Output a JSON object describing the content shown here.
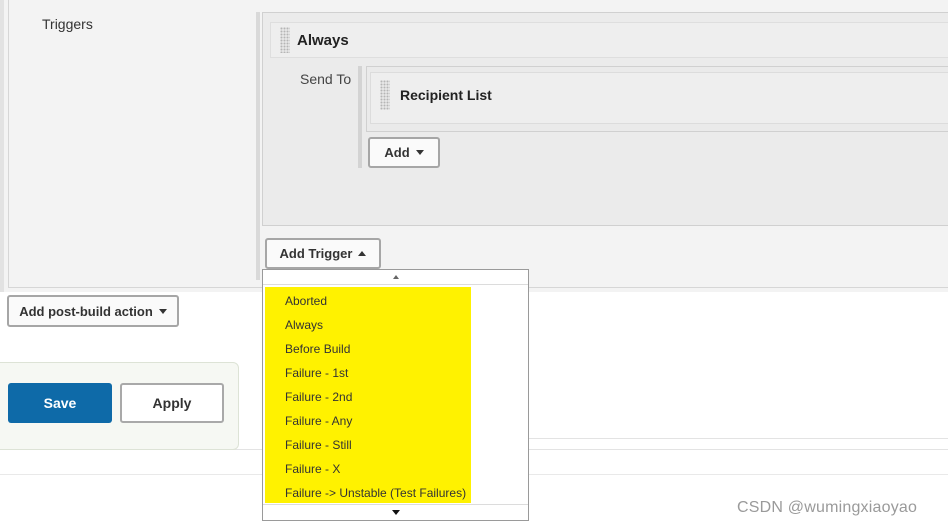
{
  "triggers": {
    "label": "Triggers",
    "trigger_title": "Always",
    "send_to_label": "Send To",
    "recipient_title": "Recipient List",
    "add_button_label": "Add",
    "add_trigger_button_label": "Add Trigger"
  },
  "post_build": {
    "add_action_label": "Add post-build action"
  },
  "trigger_menu": {
    "items": [
      "Aborted",
      "Always",
      "Before Build",
      "Failure - 1st",
      "Failure - 2nd",
      "Failure - Any",
      "Failure - Still",
      "Failure - X",
      "Failure -> Unstable (Test Failures)"
    ],
    "highlight_color": "#fff200"
  },
  "footer": {
    "save_label": "Save",
    "apply_label": "Apply"
  },
  "watermark": "CSDN @wumingxiaoyao",
  "colors": {
    "primary_button": "#0e6aa8"
  },
  "icons": {
    "drag_handle": "drag-handle-icon",
    "dropdown_caret": "caret-down-icon",
    "scroll_up": "scroll-up-icon",
    "scroll_down": "scroll-down-icon"
  }
}
